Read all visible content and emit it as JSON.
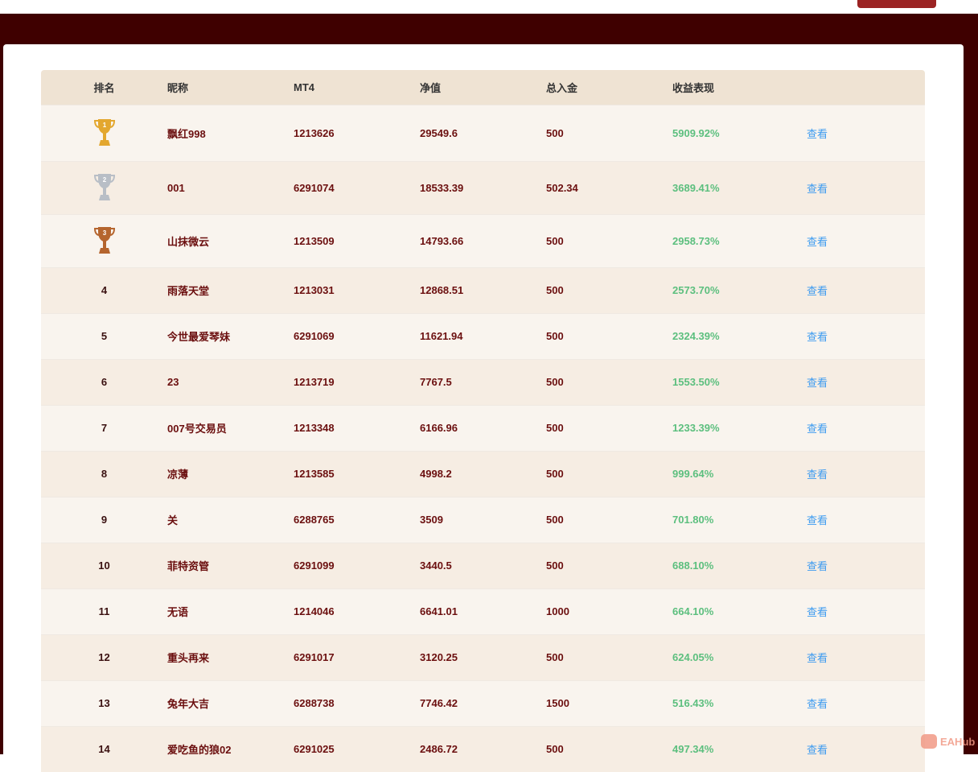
{
  "headers": [
    "排名",
    "昵称",
    "MT4",
    "净值",
    "总入金",
    "收益表现",
    ""
  ],
  "rows": [
    {
      "rank": "1",
      "trophy": "gold",
      "name": "飘红998",
      "mt4": "1213626",
      "equity": "29549.6",
      "deposit": "500",
      "gain": "5909.92%",
      "action": "查看"
    },
    {
      "rank": "2",
      "trophy": "silver",
      "name": "001",
      "mt4": "6291074",
      "equity": "18533.39",
      "deposit": "502.34",
      "gain": "3689.41%",
      "action": "查看"
    },
    {
      "rank": "3",
      "trophy": "bronze",
      "name": "山抹微云",
      "mt4": "1213509",
      "equity": "14793.66",
      "deposit": "500",
      "gain": "2958.73%",
      "action": "查看"
    },
    {
      "rank": "4",
      "name": "雨落天堂",
      "mt4": "1213031",
      "equity": "12868.51",
      "deposit": "500",
      "gain": "2573.70%",
      "action": "查看"
    },
    {
      "rank": "5",
      "name": "今世最爱琴妹",
      "mt4": "6291069",
      "equity": "11621.94",
      "deposit": "500",
      "gain": "2324.39%",
      "action": "查看"
    },
    {
      "rank": "6",
      "name": "23",
      "mt4": "1213719",
      "equity": "7767.5",
      "deposit": "500",
      "gain": "1553.50%",
      "action": "查看"
    },
    {
      "rank": "7",
      "name": "007号交易员",
      "mt4": "1213348",
      "equity": "6166.96",
      "deposit": "500",
      "gain": "1233.39%",
      "action": "查看"
    },
    {
      "rank": "8",
      "name": "凉薄",
      "mt4": "1213585",
      "equity": "4998.2",
      "deposit": "500",
      "gain": "999.64%",
      "action": "查看"
    },
    {
      "rank": "9",
      "name": "关",
      "mt4": "6288765",
      "equity": "3509",
      "deposit": "500",
      "gain": "701.80%",
      "action": "查看"
    },
    {
      "rank": "10",
      "name": "菲特资管",
      "mt4": "6291099",
      "equity": "3440.5",
      "deposit": "500",
      "gain": "688.10%",
      "action": "查看"
    },
    {
      "rank": "11",
      "name": "无语",
      "mt4": "1214046",
      "equity": "6641.01",
      "deposit": "1000",
      "gain": "664.10%",
      "action": "查看"
    },
    {
      "rank": "12",
      "name": "重头再来",
      "mt4": "6291017",
      "equity": "3120.25",
      "deposit": "500",
      "gain": "624.05%",
      "action": "查看"
    },
    {
      "rank": "13",
      "name": "兔年大吉",
      "mt4": "6288738",
      "equity": "7746.42",
      "deposit": "1500",
      "gain": "516.43%",
      "action": "查看"
    },
    {
      "rank": "14",
      "name": "爱吃鱼的狼02",
      "mt4": "6291025",
      "equity": "2486.72",
      "deposit": "500",
      "gain": "497.34%",
      "action": "查看"
    }
  ],
  "watermark": "EAHub",
  "colors": {
    "gold": "#e3a72f",
    "silver": "#b8bec6",
    "bronze": "#b5652e"
  }
}
